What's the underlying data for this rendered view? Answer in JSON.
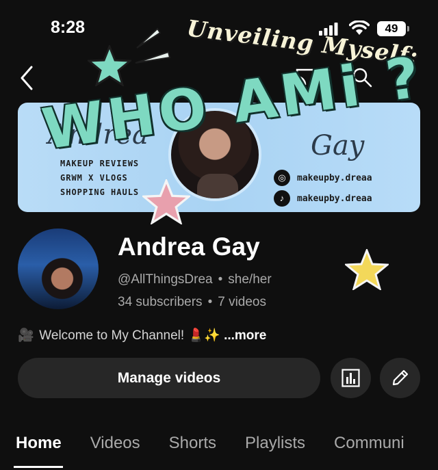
{
  "status_bar": {
    "time": "8:28",
    "battery": "49"
  },
  "banner": {
    "script_left": "Andrea",
    "script_right": "Gay",
    "tags": [
      "MAKEUP REVIEWS",
      "GRWM X VLOGS",
      "SHOPPING HAULS"
    ],
    "social": [
      {
        "icon": "instagram-icon",
        "handle": "makeupby.dreaa"
      },
      {
        "icon": "tiktok-icon",
        "handle": "makeupby.dreaa"
      }
    ]
  },
  "stickers": {
    "title": "Unveiling Myself:",
    "whoami": "WHO AMi ?"
  },
  "channel": {
    "name": "Andrea Gay",
    "handle": "@AllThingsDrea",
    "pronouns": "she/her",
    "subscribers": "34 subscribers",
    "videos": "7 videos",
    "description": "Welcome to My Channel! 💄✨",
    "more": "...more"
  },
  "actions": {
    "manage_videos": "Manage videos"
  },
  "tabs": [
    "Home",
    "Videos",
    "Shorts",
    "Playlists",
    "Communi"
  ],
  "colors": {
    "background": "#0f0f0f",
    "button": "#272727",
    "secondary_text": "#aaaaaa",
    "banner_blue": "#a9d3f3",
    "sticker_teal": "#7ed9c1"
  }
}
